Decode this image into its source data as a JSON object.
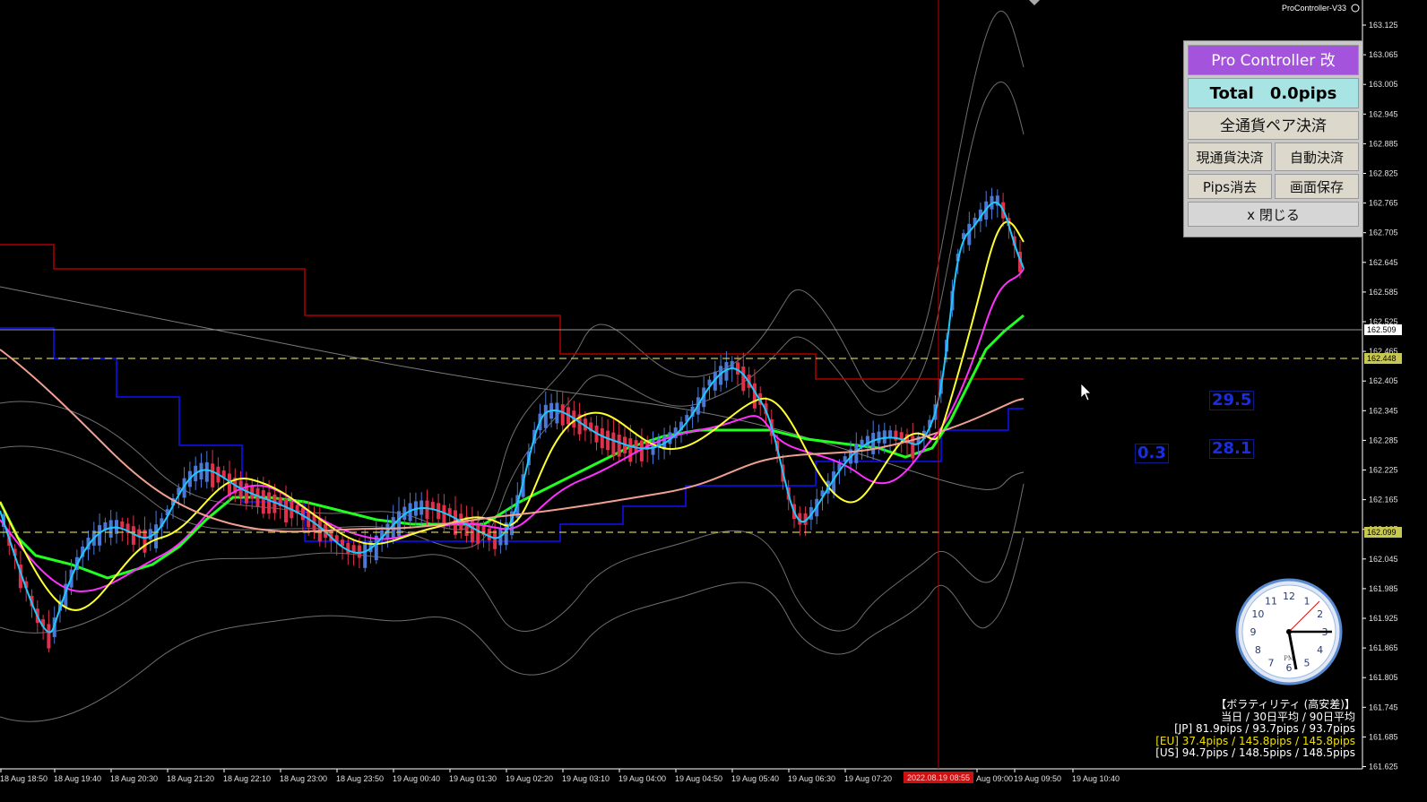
{
  "app": {
    "ea_label": "ProController-V33",
    "cursor_time_label": "2022.08.19 08:55"
  },
  "panel": {
    "title": "Pro Controller 改",
    "total": "Total　0.0pips",
    "close_all_pairs": "全通貨ペア決済",
    "close_current_pair": "現通貨決済",
    "auto_close": "自動決済",
    "clear_pips": "Pips消去",
    "screenshot": "画面保存",
    "close": "x 閉じる"
  },
  "price_axis": {
    "ticks": [
      "163.125",
      "163.065",
      "163.005",
      "162.945",
      "162.885",
      "162.825",
      "162.765",
      "162.705",
      "162.645",
      "162.585",
      "162.525",
      "162.465",
      "162.405",
      "162.345",
      "162.285",
      "162.225",
      "162.165",
      "162.105",
      "162.045",
      "161.985",
      "161.925",
      "161.865",
      "161.805",
      "161.745",
      "161.685",
      "161.625"
    ],
    "current_price": "162.509",
    "upper_line_price": "162.448",
    "lower_line_price": "162.099"
  },
  "time_axis": {
    "ticks": [
      "18 Aug 18:50",
      "18 Aug 19:40",
      "18 Aug 20:30",
      "18 Aug 21:20",
      "18 Aug 22:10",
      "18 Aug 23:00",
      "18 Aug 23:50",
      "19 Aug 00:40",
      "19 Aug 01:30",
      "19 Aug 02:20",
      "19 Aug 03:10",
      "19 Aug 04:00",
      "19 Aug 04:50",
      "19 Aug 05:40",
      "19 Aug 06:30",
      "19 Aug 07:20",
      "Aug 09:00",
      "19 Aug 09:50",
      "19 Aug 10:40"
    ]
  },
  "boxes": {
    "b1": "29.5",
    "b2": "28.1",
    "b3": "0.3"
  },
  "volatility": {
    "title": "【ボラティリティ (高安差)】",
    "header": "当日 / 30日平均 / 90日平均",
    "jp": "[JP] 81.9pips / 93.7pips / 93.7pips",
    "eu": "[EU] 37.4pips / 145.8pips / 145.8pips",
    "us": "[US] 94.7pips / 148.5pips / 148.5pips"
  },
  "colors": {
    "background": "#000000",
    "bull_candle": "#4a78d4",
    "bear_candle": "#e0304a",
    "ema_fast": "#1ec8ff",
    "ema_mid": "#ffff30",
    "ema_slow": "#ff30ff",
    "ma_long": "#f0a090",
    "step_green": "#20ff20",
    "step_red": "#b00000",
    "step_blue": "#0000ff",
    "vertical_line": "#c00000",
    "dashed_lines": "#c8c850"
  }
}
